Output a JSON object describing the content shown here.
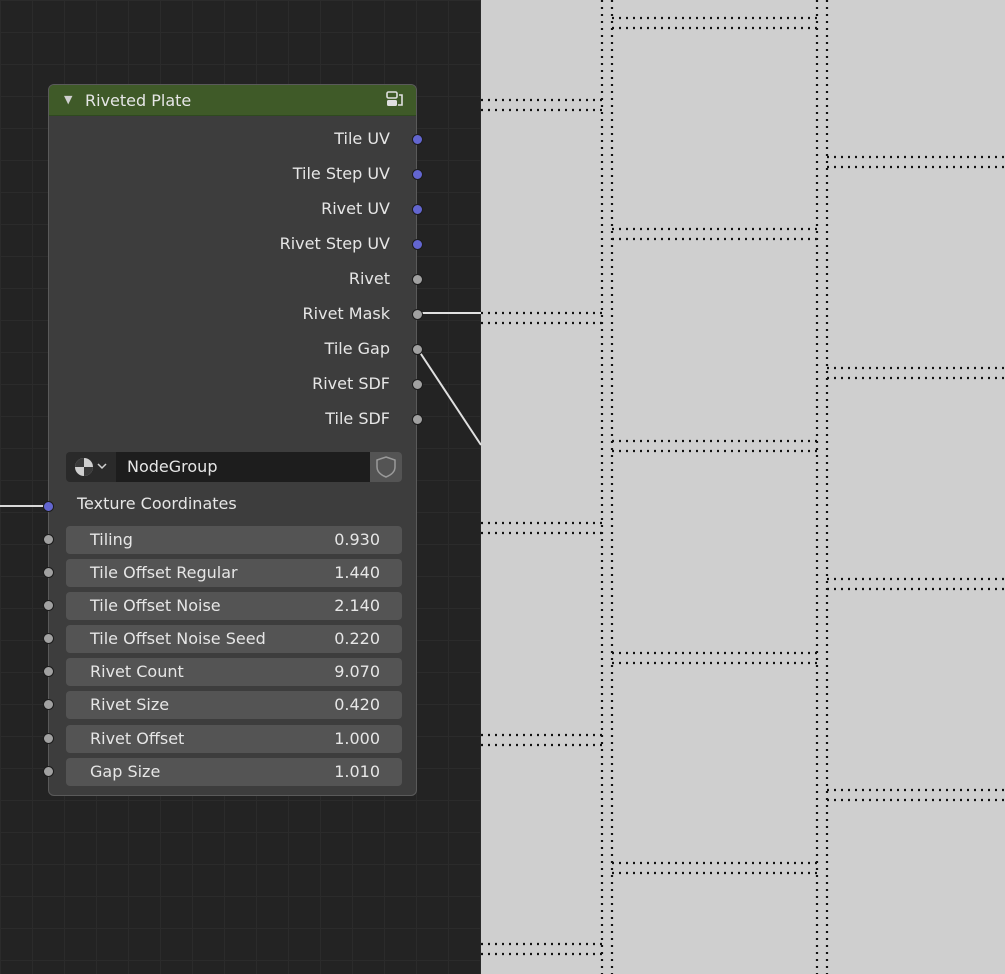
{
  "node": {
    "title": "Riveted Plate",
    "header_color": "#3f5a28",
    "collapse_icon": "triangle-down-icon",
    "group_icon": "node-group-icon",
    "outputs": [
      {
        "label": "Tile UV",
        "socket": "vector"
      },
      {
        "label": "Tile Step UV",
        "socket": "vector"
      },
      {
        "label": "Rivet UV",
        "socket": "vector"
      },
      {
        "label": "Rivet Step UV",
        "socket": "vector"
      },
      {
        "label": "Rivet",
        "socket": "float"
      },
      {
        "label": "Rivet Mask",
        "socket": "float"
      },
      {
        "label": "Tile Gap",
        "socket": "float"
      },
      {
        "label": "Rivet SDF",
        "socket": "float"
      },
      {
        "label": "Tile SDF",
        "socket": "float"
      }
    ],
    "datablock": {
      "type_icon": "node-tree-icon",
      "name": "NodeGroup",
      "fake_user_icon": "shield-icon"
    },
    "texture_coordinates_label": "Texture Coordinates",
    "inputs": [
      {
        "label": "Tiling",
        "value": "0.930"
      },
      {
        "label": "Tile Offset Regular",
        "value": "1.440"
      },
      {
        "label": "Tile Offset Noise",
        "value": "2.140"
      },
      {
        "label": "Tile Offset Noise Seed",
        "value": "0.220"
      },
      {
        "label": "Rivet Count",
        "value": "9.070"
      },
      {
        "label": "Rivet Size",
        "value": "0.420"
      },
      {
        "label": "Rivet Offset",
        "value": "1.000"
      },
      {
        "label": "Gap Size",
        "value": "1.010"
      }
    ]
  },
  "colors": {
    "vector_socket": "#6366d0",
    "float_socket": "#a1a1a1",
    "preview_background": "#cfcfcf"
  }
}
